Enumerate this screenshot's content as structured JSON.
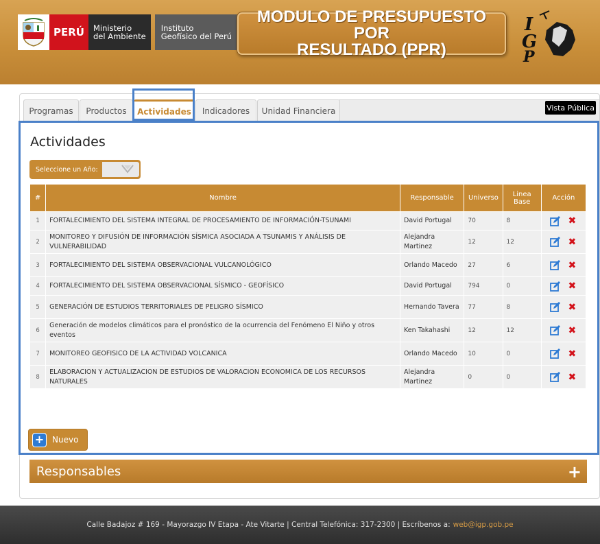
{
  "header": {
    "peru": "PERÚ",
    "ministerio_line1": "Ministerio",
    "ministerio_line2": "del Ambiente",
    "instituto_line1": "Instituto",
    "instituto_line2": "Geofísico del Perú",
    "title_line1": "MODULO DE PRESUPUESTO POR",
    "title_line2": "RESULTADO (PPR)",
    "igp_text": "IGP"
  },
  "tabs": [
    {
      "label": "Programas"
    },
    {
      "label": "Productos"
    },
    {
      "label": "Actividades"
    },
    {
      "label": "Indicadores"
    },
    {
      "label": "Unidad Financiera"
    }
  ],
  "active_tab": "Actividades",
  "vista_publica": "Vista Pública",
  "section_title": "Actividades",
  "year_select": {
    "label": "Seleccione un Año:"
  },
  "table": {
    "headers": [
      "#",
      "Nombre",
      "Responsable",
      "Universo",
      "Linea Base",
      "Acción"
    ],
    "rows": [
      {
        "n": "1",
        "nombre": "FORTALECIMIENTO DEL SISTEMA INTEGRAL DE PROCESAMIENTO DE INFORMACIÓN-TSUNAMI",
        "responsable": "David Portugal",
        "universo": "70",
        "linea_base": "8"
      },
      {
        "n": "2",
        "nombre": "MONITOREO Y DIFUSIÓN DE INFORMACIÓN SÍSMICA ASOCIADA A TSUNAMIS Y ANÁLISIS DE VULNERABILIDAD",
        "responsable": "Alejandra Martinez",
        "universo": "12",
        "linea_base": "12"
      },
      {
        "n": "3",
        "nombre": "FORTALECIMIENTO DEL SISTEMA OBSERVACIONAL VULCANOLÓGICO",
        "responsable": "Orlando Macedo",
        "universo": "27",
        "linea_base": "6"
      },
      {
        "n": "4",
        "nombre": "FORTALECIMIENTO DEL SISTEMA OBSERVACIONAL SÍSMICO - GEOFÍSICO",
        "responsable": "David Portugal",
        "universo": "794",
        "linea_base": "0"
      },
      {
        "n": "5",
        "nombre": "GENERACIÓN DE ESTUDIOS TERRITORIALES DE PELIGRO SÍSMICO",
        "responsable": "Hernando Tavera",
        "universo": "77",
        "linea_base": "8"
      },
      {
        "n": "6",
        "nombre": "Generación de modelos climáticos para el pronóstico de la ocurrencia del Fenómeno El Niño y otros eventos",
        "responsable": "Ken Takahashi",
        "universo": "12",
        "linea_base": "12"
      },
      {
        "n": "7",
        "nombre": "MONITOREO GEOFISICO DE LA ACTIVIDAD VOLCANICA",
        "responsable": "Orlando Macedo",
        "universo": "10",
        "linea_base": "0"
      },
      {
        "n": "8",
        "nombre": "ELABORACION Y ACTUALIZACION DE ESTUDIOS DE VALORACION ECONOMICA DE LOS RECURSOS NATURALES",
        "responsable": "Alejandra Martinez",
        "universo": "0",
        "linea_base": "0"
      }
    ]
  },
  "nuevo_button": "Nuevo",
  "responsables_title": "Responsables",
  "footer": {
    "text": "Calle Badajoz # 169 - Mayorazgo IV Etapa - Ate Vitarte | Central Telefónica: 317-2300 | Escríbenos a:",
    "email": "web@igp.gob.pe"
  },
  "colors": {
    "accent": "#c78a33",
    "highlight": "#4a80c8",
    "delete": "#d3121a",
    "edit": "#2e7bd4"
  }
}
